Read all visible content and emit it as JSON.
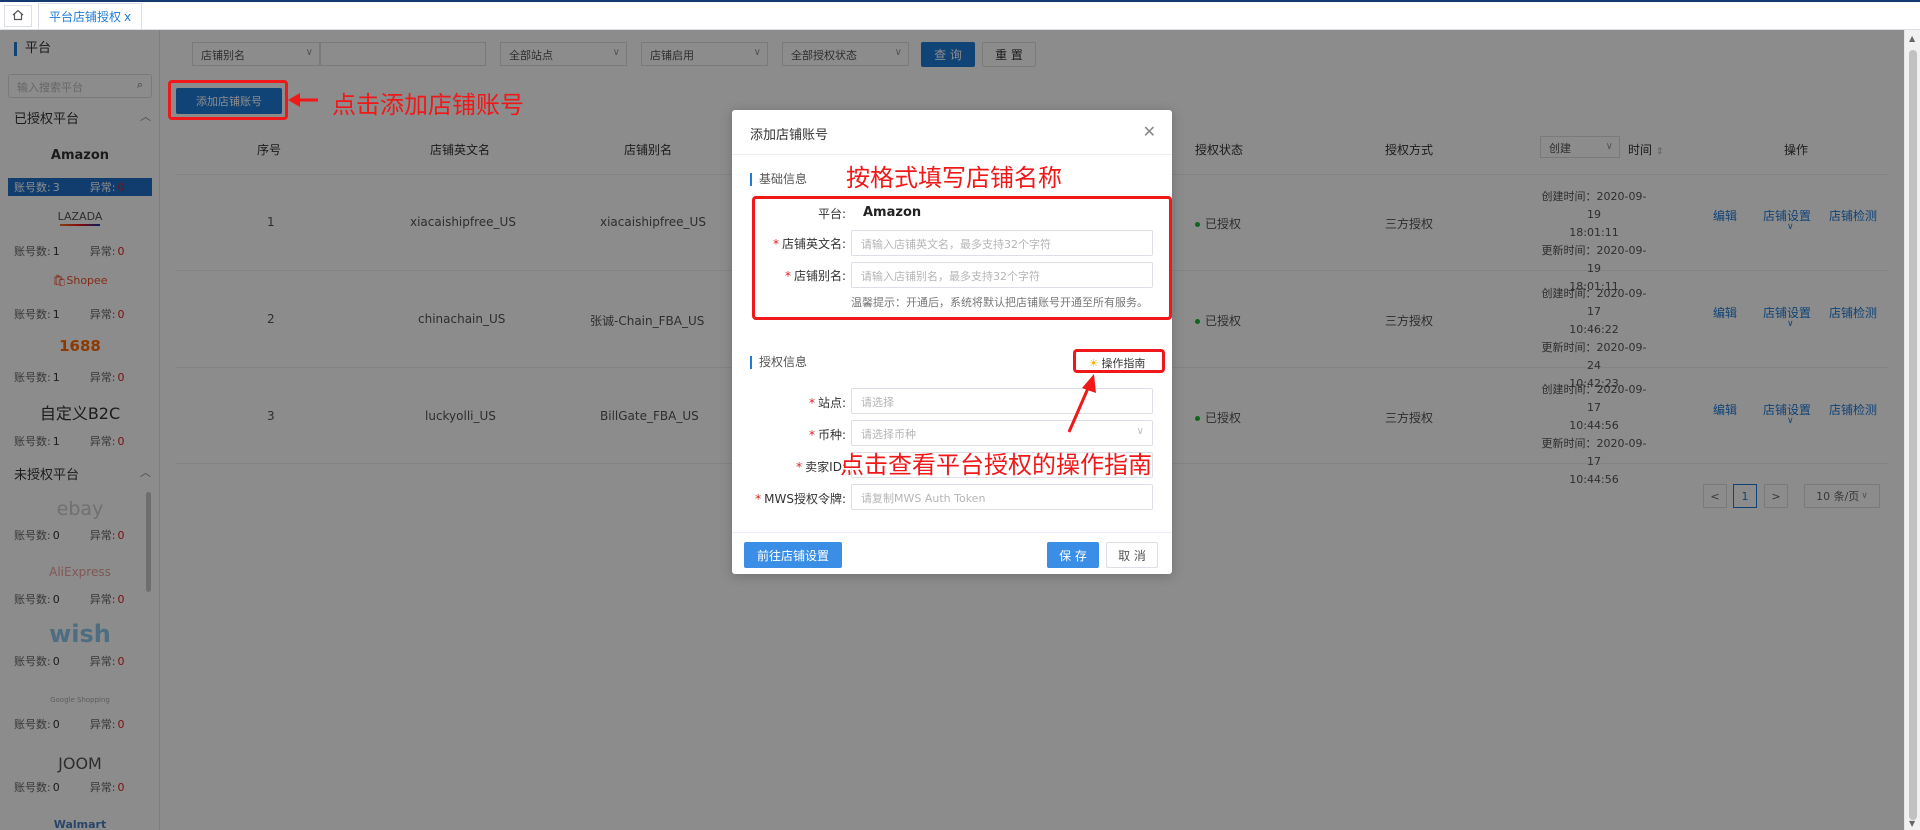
{
  "tabs": {
    "home_icon": "home-icon",
    "active": "平台店铺授权",
    "close": "x"
  },
  "sidebar": {
    "title": "平台",
    "search_placeholder": "输入搜索平台",
    "authorized_group": "已授权平台",
    "unauthorized_group": "未授权平台",
    "count_label": "账号数:",
    "error_label": "异常:",
    "platforms": [
      {
        "name": "Amazon",
        "count": "3",
        "errors": "0"
      },
      {
        "name": "LAZADA",
        "count": "1",
        "errors": "0"
      },
      {
        "name": "Shopee",
        "count": "1",
        "errors": "0"
      },
      {
        "name": "1688",
        "count": "1",
        "errors": "0"
      },
      {
        "name": "自定义B2C",
        "count": "1",
        "errors": "0"
      },
      {
        "name": "ebay",
        "count": "0",
        "errors": "0"
      },
      {
        "name": "AliExpress",
        "count": "0",
        "errors": "0"
      },
      {
        "name": "wish",
        "count": "0",
        "errors": "0"
      },
      {
        "name": "Google Shopping",
        "count": "0",
        "errors": "0"
      },
      {
        "name": "JOOM",
        "count": "0",
        "errors": "0"
      },
      {
        "name": "Walmart"
      }
    ]
  },
  "filters": {
    "alias_select": "店铺别名",
    "site_select": "全部站点",
    "status_select": "店铺启用",
    "auth_select": "全部授权状态",
    "query_button": "查 询",
    "reset_button": "重 置"
  },
  "add_account_button": "添加店铺账号",
  "table": {
    "headers": {
      "index": "序号",
      "en_name": "店铺英文名",
      "alias": "店铺别名",
      "auth_status": "授权状态",
      "auth_method": "授权方式",
      "time_sort": "创建",
      "time": "时间",
      "action": "操作"
    },
    "rows": [
      {
        "index": "1",
        "en_name": "xiacaishipfree_US",
        "alias": "xiacaishipfree_US",
        "status": "已授权",
        "method": "三方授权",
        "created": "创建时间：2020-09-19",
        "created_time": "18:01:11",
        "updated": "更新时间：2020-09-19",
        "updated_time": "18:01:11"
      },
      {
        "index": "2",
        "en_name": "chinachain_US",
        "alias": "张诚-Chain_FBA_US",
        "status": "已授权",
        "method": "三方授权",
        "created": "创建时间：2020-09-17",
        "created_time": "10:46:22",
        "updated": "更新时间：2020-09-24",
        "updated_time": "10:42:23"
      },
      {
        "index": "3",
        "en_name": "luckyolli_US",
        "alias": "BillGate_FBA_US",
        "status": "已授权",
        "method": "三方授权",
        "created": "创建时间：2020-09-17",
        "created_time": "10:44:56",
        "updated": "更新时间：2020-09-17",
        "updated_time": "10:44:56"
      }
    ],
    "actions": {
      "edit": "编辑",
      "settings": "店铺设置",
      "check": "店铺检测"
    }
  },
  "pagination": {
    "prev": "<",
    "current": "1",
    "next": ">",
    "page_size": "10 条/页"
  },
  "modal": {
    "title": "添加店铺账号",
    "basic_section": "基础信息",
    "platform_label": "平台:",
    "platform_value": "Amazon",
    "en_name_label": "店铺英文名:",
    "en_name_placeholder": "请输入店铺英文名，最多支持32个字符",
    "alias_label": "店铺别名:",
    "alias_placeholder": "请输入店铺别名，最多支持32个字符",
    "tip": "温馨提示：开通后，系统将默认把店铺账号开通至所有服务。",
    "auth_section": "授权信息",
    "guide_button": "操作指南",
    "site_label": "站点:",
    "site_placeholder": "请选择",
    "currency_label": "币种:",
    "currency_placeholder": "请选择币种",
    "seller_label": "卖家ID:",
    "mws_label": "MWS授权令牌:",
    "mws_placeholder": "请复制MWS Auth Token",
    "goto_button": "前往店铺设置",
    "save_button": "保 存",
    "cancel_button": "取 消"
  },
  "annotations": {
    "add_hint": "点击添加店铺账号",
    "fill_hint": "按格式填写店铺名称",
    "guide_hint": "点击查看平台授权的操作指南"
  },
  "colors": {
    "accent": "#1e7bd8",
    "annotation": "#f01818",
    "error": "#e02020",
    "success": "#1bb934"
  }
}
